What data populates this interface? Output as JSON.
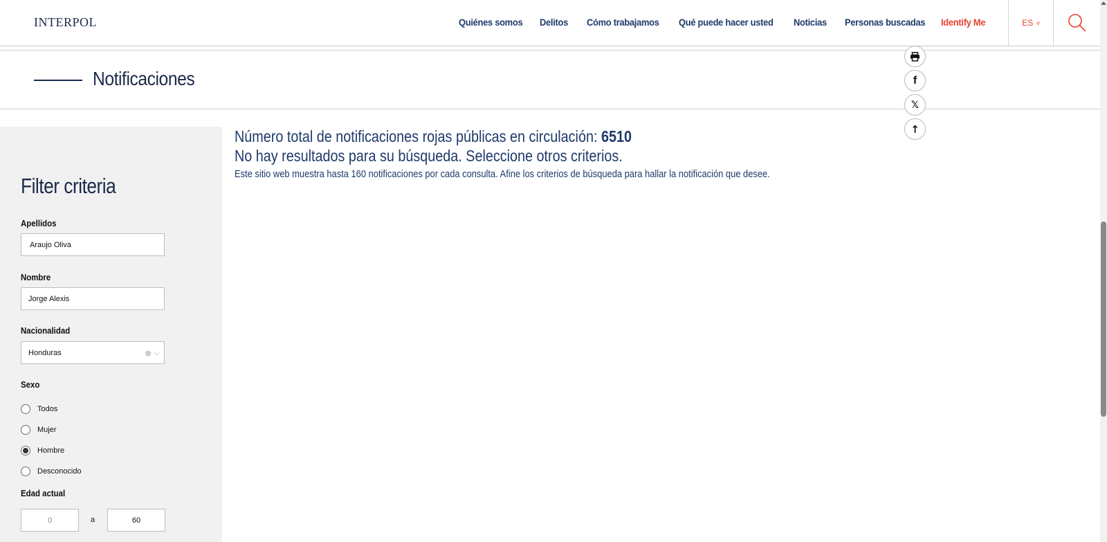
{
  "header": {
    "logo": "INTERPOL",
    "nav": [
      {
        "label": "Quiénes somos"
      },
      {
        "label": "Delitos"
      },
      {
        "label": "Cómo trabajamos"
      },
      {
        "label": "Qué puede hacer usted"
      },
      {
        "label": "Noticias"
      },
      {
        "label": "Personas buscadas"
      },
      {
        "label": "Identify Me"
      }
    ],
    "lang": "ES",
    "lang_chevron": "v"
  },
  "page": {
    "title": "Notificaciones"
  },
  "share": {
    "print_icon": "print-icon",
    "facebook": "f",
    "x": "𝕏",
    "up": "↑"
  },
  "filters": {
    "title": "Filter criteria",
    "apellidos": {
      "label": "Apellidos",
      "value": "Araujo Oliva"
    },
    "nombre": {
      "label": "Nombre",
      "value": "Jorge Alexis"
    },
    "nacionalidad": {
      "label": "Nacionalidad",
      "value": "Honduras",
      "clear_icon": "⊗",
      "chevron": "⌵"
    },
    "sexo": {
      "label": "Sexo",
      "options": [
        {
          "label": "Todos",
          "selected": false
        },
        {
          "label": "Mujer",
          "selected": false
        },
        {
          "label": "Hombre",
          "selected": true
        },
        {
          "label": "Desconocido",
          "selected": false
        }
      ]
    },
    "edad": {
      "label": "Edad actual",
      "min": "0",
      "separator": "a",
      "max": "60"
    }
  },
  "results": {
    "total_prefix": "Número total de notificaciones rojas públicas en circulación: ",
    "total_count": "6510",
    "no_results": "No hay resultados para su búsqueda. Seleccione otros criterios.",
    "note": "Este sitio web muestra hasta 160 notificaciones por cada consulta. Afine los criterios de búsqueda para hallar la notificación que desee."
  },
  "colors": {
    "navy": "#1e3a6b",
    "accent_red": "#e8412d",
    "sidebar_bg": "#f1f1f1"
  }
}
